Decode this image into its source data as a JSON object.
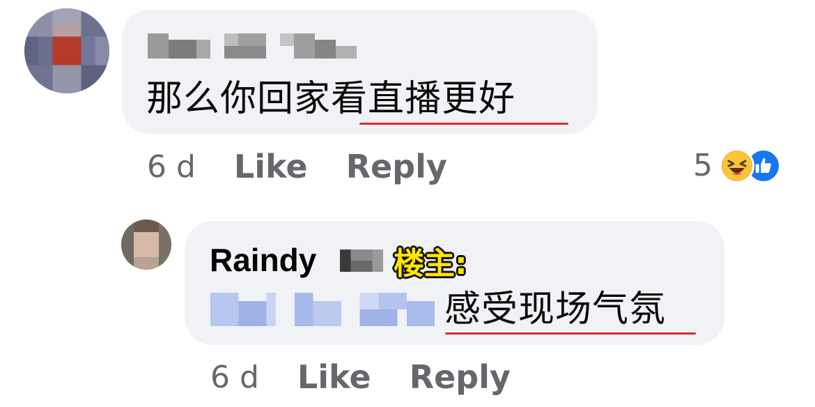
{
  "comments": [
    {
      "text_plain": "那么你回家",
      "text_underlined": "看直播更好",
      "time": "6 d",
      "like_label": "Like",
      "reply_label": "Reply",
      "reactions": {
        "count": "5",
        "icons": [
          "laughing-face-icon",
          "thumbs-up-icon"
        ]
      }
    }
  ],
  "reply": {
    "author": "Raindy",
    "tag": "楼主:",
    "text_underlined": "感受现场气氛",
    "time": "6 d",
    "like_label": "Like",
    "reply_label": "Reply"
  },
  "colors": {
    "bubble": "#f0f2f5",
    "meta_text": "#65676b",
    "underline": "#e0282e",
    "tag_fill": "#ffe600",
    "like_blue": "#1877f2",
    "haha_yellow": "#f7b125"
  }
}
